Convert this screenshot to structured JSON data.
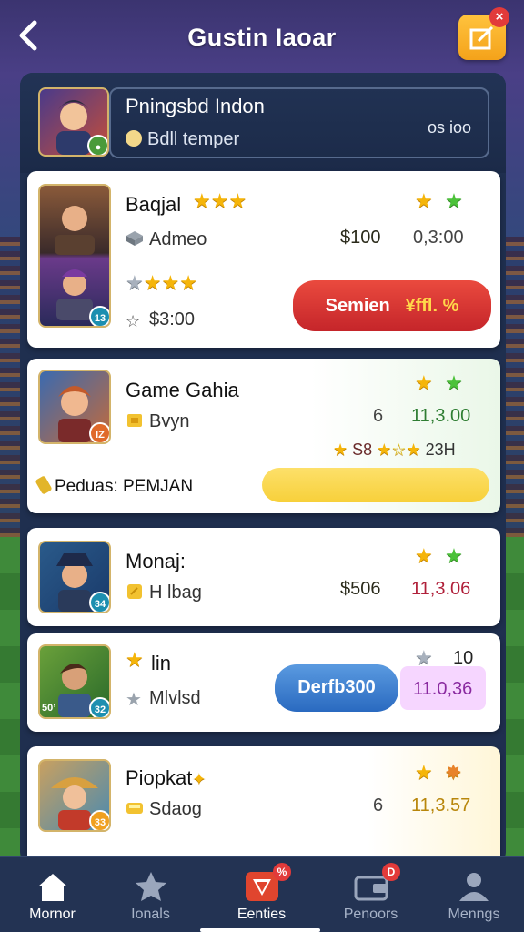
{
  "header": {
    "title": "Gustin Iaoar"
  },
  "profile": {
    "name": "Pningsbd Indon",
    "subtitle": "Bdll temper",
    "value": "os ioo"
  },
  "cards": [
    {
      "name": "Baqjal",
      "tag": "Admeo",
      "price": "$100",
      "score": "0,3:00",
      "sub2": "$3:00",
      "button": "Semien",
      "button_extra": "¥ffl. %",
      "badge": "13"
    },
    {
      "name": "Game Gahia",
      "tag": "Bvyn",
      "price": "6",
      "score": "11,3.00",
      "row2_a": "S8",
      "row2_b": "23H",
      "footer_label": "Peduas: PEMJAN",
      "badge": "IZ"
    },
    {
      "name": "Monaj:",
      "tag": "H lbag",
      "price": "$506",
      "score": "11,3.06",
      "badge": "34"
    },
    {
      "name": "lin",
      "tag": "Mlvlsd",
      "button": "Derfb300",
      "score": "11.0,36",
      "top_value": "10",
      "badge": "32",
      "badge_left": "50’"
    },
    {
      "name": "Piopkat",
      "tag": "Sdaog",
      "price": "6",
      "score": "11,3.57",
      "badge": "33"
    }
  ],
  "nav": [
    {
      "label": "Mornor",
      "icon": "home-icon"
    },
    {
      "label": "Ionals",
      "icon": "star-icon"
    },
    {
      "label": "Eenties",
      "icon": "shield-icon",
      "badge": "%"
    },
    {
      "label": "Penoors",
      "icon": "wallet-icon",
      "badge": "D"
    },
    {
      "label": "Menngs",
      "icon": "profile-icon"
    }
  ],
  "colors": {
    "accent": "#f4a21a",
    "danger": "#e0393a",
    "success": "#2e7d32",
    "nav_bg": "#233353"
  }
}
